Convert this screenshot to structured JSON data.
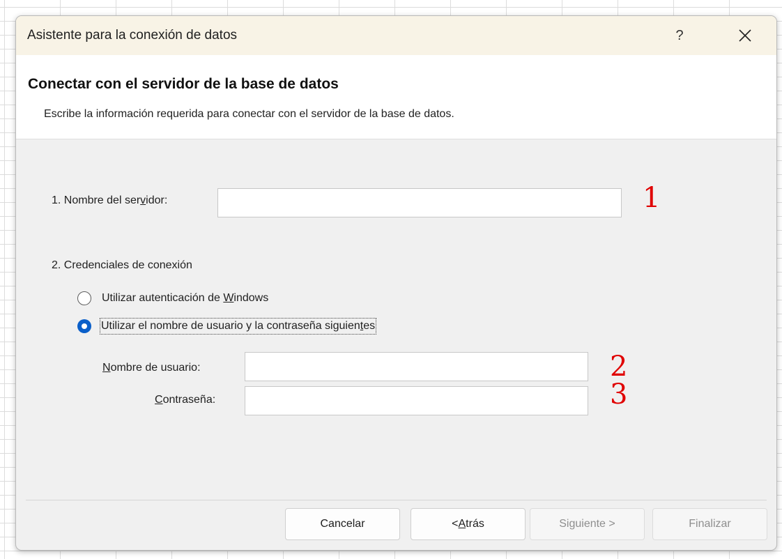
{
  "dialog": {
    "title": "Asistente para la conexión de datos",
    "help_label": "?",
    "close_icon": "close-icon"
  },
  "header": {
    "title": "Conectar con el servidor de la base de datos",
    "description": "Escribe la información requerida para conectar con el servidor de la base de datos."
  },
  "server": {
    "label_before": "1. Nombre del ser",
    "label_access": "v",
    "label_after": "idor:",
    "value": "",
    "marker": "1"
  },
  "credentials": {
    "section_label": "2. Credenciales de conexión",
    "options": [
      {
        "before": "Utilizar autenticación de ",
        "access": "W",
        "after": "indows",
        "selected": false
      },
      {
        "before": "Utilizar el nombre de usuario y la contraseña siguien",
        "access": "t",
        "after": "es",
        "selected": true
      }
    ],
    "username": {
      "access": "N",
      "label_rest": "ombre de usuario:",
      "value": "",
      "marker": "2"
    },
    "password": {
      "access": "C",
      "label_rest": "ontraseña:",
      "value": "",
      "marker": "3"
    }
  },
  "buttons": {
    "cancel": "Cancelar",
    "back_before": "< ",
    "back_access": "A",
    "back_after": "trás",
    "next": "Siguiente >",
    "finish": "Finalizar"
  },
  "colors": {
    "accent": "#0a5fc9",
    "marker": "#e00000",
    "titlebar": "#f8f3e6"
  }
}
